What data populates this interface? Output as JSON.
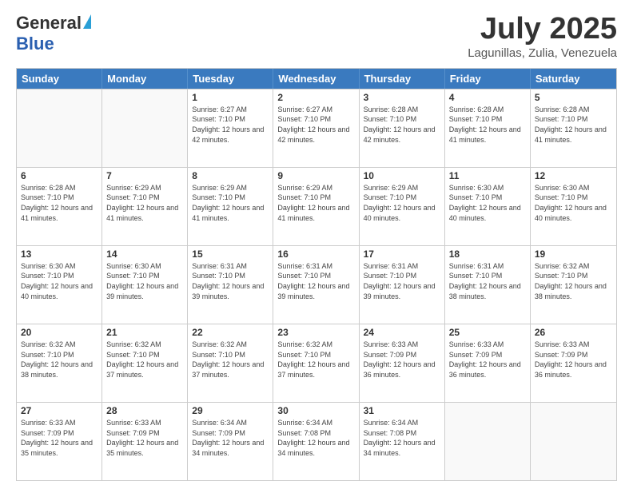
{
  "header": {
    "logo_general": "General",
    "logo_blue": "Blue",
    "month_title": "July 2025",
    "subtitle": "Lagunillas, Zulia, Venezuela"
  },
  "calendar": {
    "weekdays": [
      "Sunday",
      "Monday",
      "Tuesday",
      "Wednesday",
      "Thursday",
      "Friday",
      "Saturday"
    ],
    "rows": [
      [
        {
          "day": "",
          "empty": true
        },
        {
          "day": "",
          "empty": true
        },
        {
          "day": "1",
          "sunrise": "6:27 AM",
          "sunset": "7:10 PM",
          "daylight": "12 hours and 42 minutes."
        },
        {
          "day": "2",
          "sunrise": "6:27 AM",
          "sunset": "7:10 PM",
          "daylight": "12 hours and 42 minutes."
        },
        {
          "day": "3",
          "sunrise": "6:28 AM",
          "sunset": "7:10 PM",
          "daylight": "12 hours and 42 minutes."
        },
        {
          "day": "4",
          "sunrise": "6:28 AM",
          "sunset": "7:10 PM",
          "daylight": "12 hours and 41 minutes."
        },
        {
          "day": "5",
          "sunrise": "6:28 AM",
          "sunset": "7:10 PM",
          "daylight": "12 hours and 41 minutes."
        }
      ],
      [
        {
          "day": "6",
          "sunrise": "6:28 AM",
          "sunset": "7:10 PM",
          "daylight": "12 hours and 41 minutes."
        },
        {
          "day": "7",
          "sunrise": "6:29 AM",
          "sunset": "7:10 PM",
          "daylight": "12 hours and 41 minutes."
        },
        {
          "day": "8",
          "sunrise": "6:29 AM",
          "sunset": "7:10 PM",
          "daylight": "12 hours and 41 minutes."
        },
        {
          "day": "9",
          "sunrise": "6:29 AM",
          "sunset": "7:10 PM",
          "daylight": "12 hours and 41 minutes."
        },
        {
          "day": "10",
          "sunrise": "6:29 AM",
          "sunset": "7:10 PM",
          "daylight": "12 hours and 40 minutes."
        },
        {
          "day": "11",
          "sunrise": "6:30 AM",
          "sunset": "7:10 PM",
          "daylight": "12 hours and 40 minutes."
        },
        {
          "day": "12",
          "sunrise": "6:30 AM",
          "sunset": "7:10 PM",
          "daylight": "12 hours and 40 minutes."
        }
      ],
      [
        {
          "day": "13",
          "sunrise": "6:30 AM",
          "sunset": "7:10 PM",
          "daylight": "12 hours and 40 minutes."
        },
        {
          "day": "14",
          "sunrise": "6:30 AM",
          "sunset": "7:10 PM",
          "daylight": "12 hours and 39 minutes."
        },
        {
          "day": "15",
          "sunrise": "6:31 AM",
          "sunset": "7:10 PM",
          "daylight": "12 hours and 39 minutes."
        },
        {
          "day": "16",
          "sunrise": "6:31 AM",
          "sunset": "7:10 PM",
          "daylight": "12 hours and 39 minutes."
        },
        {
          "day": "17",
          "sunrise": "6:31 AM",
          "sunset": "7:10 PM",
          "daylight": "12 hours and 39 minutes."
        },
        {
          "day": "18",
          "sunrise": "6:31 AM",
          "sunset": "7:10 PM",
          "daylight": "12 hours and 38 minutes."
        },
        {
          "day": "19",
          "sunrise": "6:32 AM",
          "sunset": "7:10 PM",
          "daylight": "12 hours and 38 minutes."
        }
      ],
      [
        {
          "day": "20",
          "sunrise": "6:32 AM",
          "sunset": "7:10 PM",
          "daylight": "12 hours and 38 minutes."
        },
        {
          "day": "21",
          "sunrise": "6:32 AM",
          "sunset": "7:10 PM",
          "daylight": "12 hours and 37 minutes."
        },
        {
          "day": "22",
          "sunrise": "6:32 AM",
          "sunset": "7:10 PM",
          "daylight": "12 hours and 37 minutes."
        },
        {
          "day": "23",
          "sunrise": "6:32 AM",
          "sunset": "7:10 PM",
          "daylight": "12 hours and 37 minutes."
        },
        {
          "day": "24",
          "sunrise": "6:33 AM",
          "sunset": "7:09 PM",
          "daylight": "12 hours and 36 minutes."
        },
        {
          "day": "25",
          "sunrise": "6:33 AM",
          "sunset": "7:09 PM",
          "daylight": "12 hours and 36 minutes."
        },
        {
          "day": "26",
          "sunrise": "6:33 AM",
          "sunset": "7:09 PM",
          "daylight": "12 hours and 36 minutes."
        }
      ],
      [
        {
          "day": "27",
          "sunrise": "6:33 AM",
          "sunset": "7:09 PM",
          "daylight": "12 hours and 35 minutes."
        },
        {
          "day": "28",
          "sunrise": "6:33 AM",
          "sunset": "7:09 PM",
          "daylight": "12 hours and 35 minutes."
        },
        {
          "day": "29",
          "sunrise": "6:34 AM",
          "sunset": "7:09 PM",
          "daylight": "12 hours and 34 minutes."
        },
        {
          "day": "30",
          "sunrise": "6:34 AM",
          "sunset": "7:08 PM",
          "daylight": "12 hours and 34 minutes."
        },
        {
          "day": "31",
          "sunrise": "6:34 AM",
          "sunset": "7:08 PM",
          "daylight": "12 hours and 34 minutes."
        },
        {
          "day": "",
          "empty": true
        },
        {
          "day": "",
          "empty": true
        }
      ]
    ]
  }
}
